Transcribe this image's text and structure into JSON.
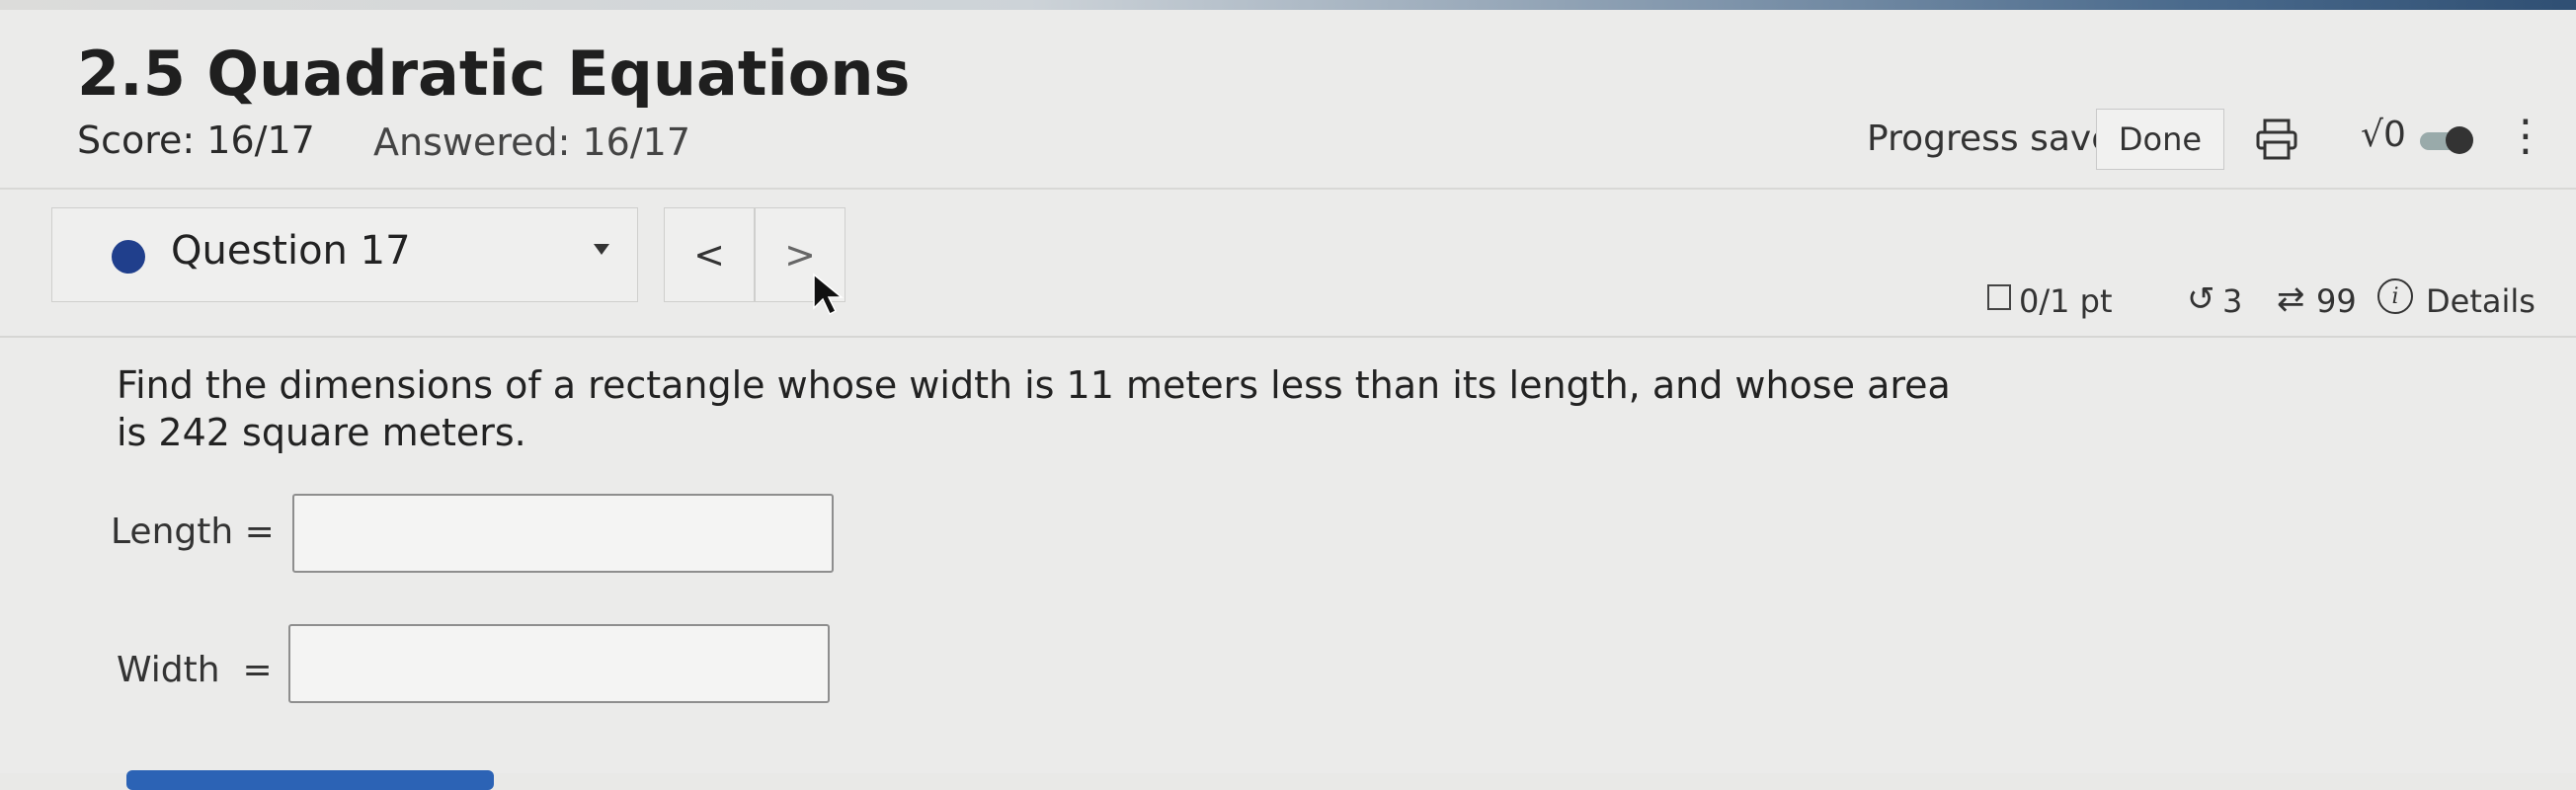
{
  "header": {
    "title": "2.5 Quadratic Equations",
    "score": "Score: 16/17",
    "answered": "Answered: 16/17",
    "progress_saved": "Progress saved",
    "done_label": "Done",
    "sqrt_label": "√0"
  },
  "question_nav": {
    "question_label": "Question 17",
    "prev_label": "<",
    "next_label": ">"
  },
  "meta": {
    "points": "0/1 pt",
    "retries": "3",
    "attempts": "99",
    "details_label": "Details"
  },
  "question": {
    "text": "Find the dimensions of a rectangle whose width is 11 meters less than its length, and whose area is 242 square meters.",
    "fields": [
      {
        "label": "Length =",
        "value": ""
      },
      {
        "label": "Width  =",
        "value": ""
      }
    ]
  },
  "colors": {
    "accent": "#203f8c",
    "button_blue": "#2c63b5"
  }
}
